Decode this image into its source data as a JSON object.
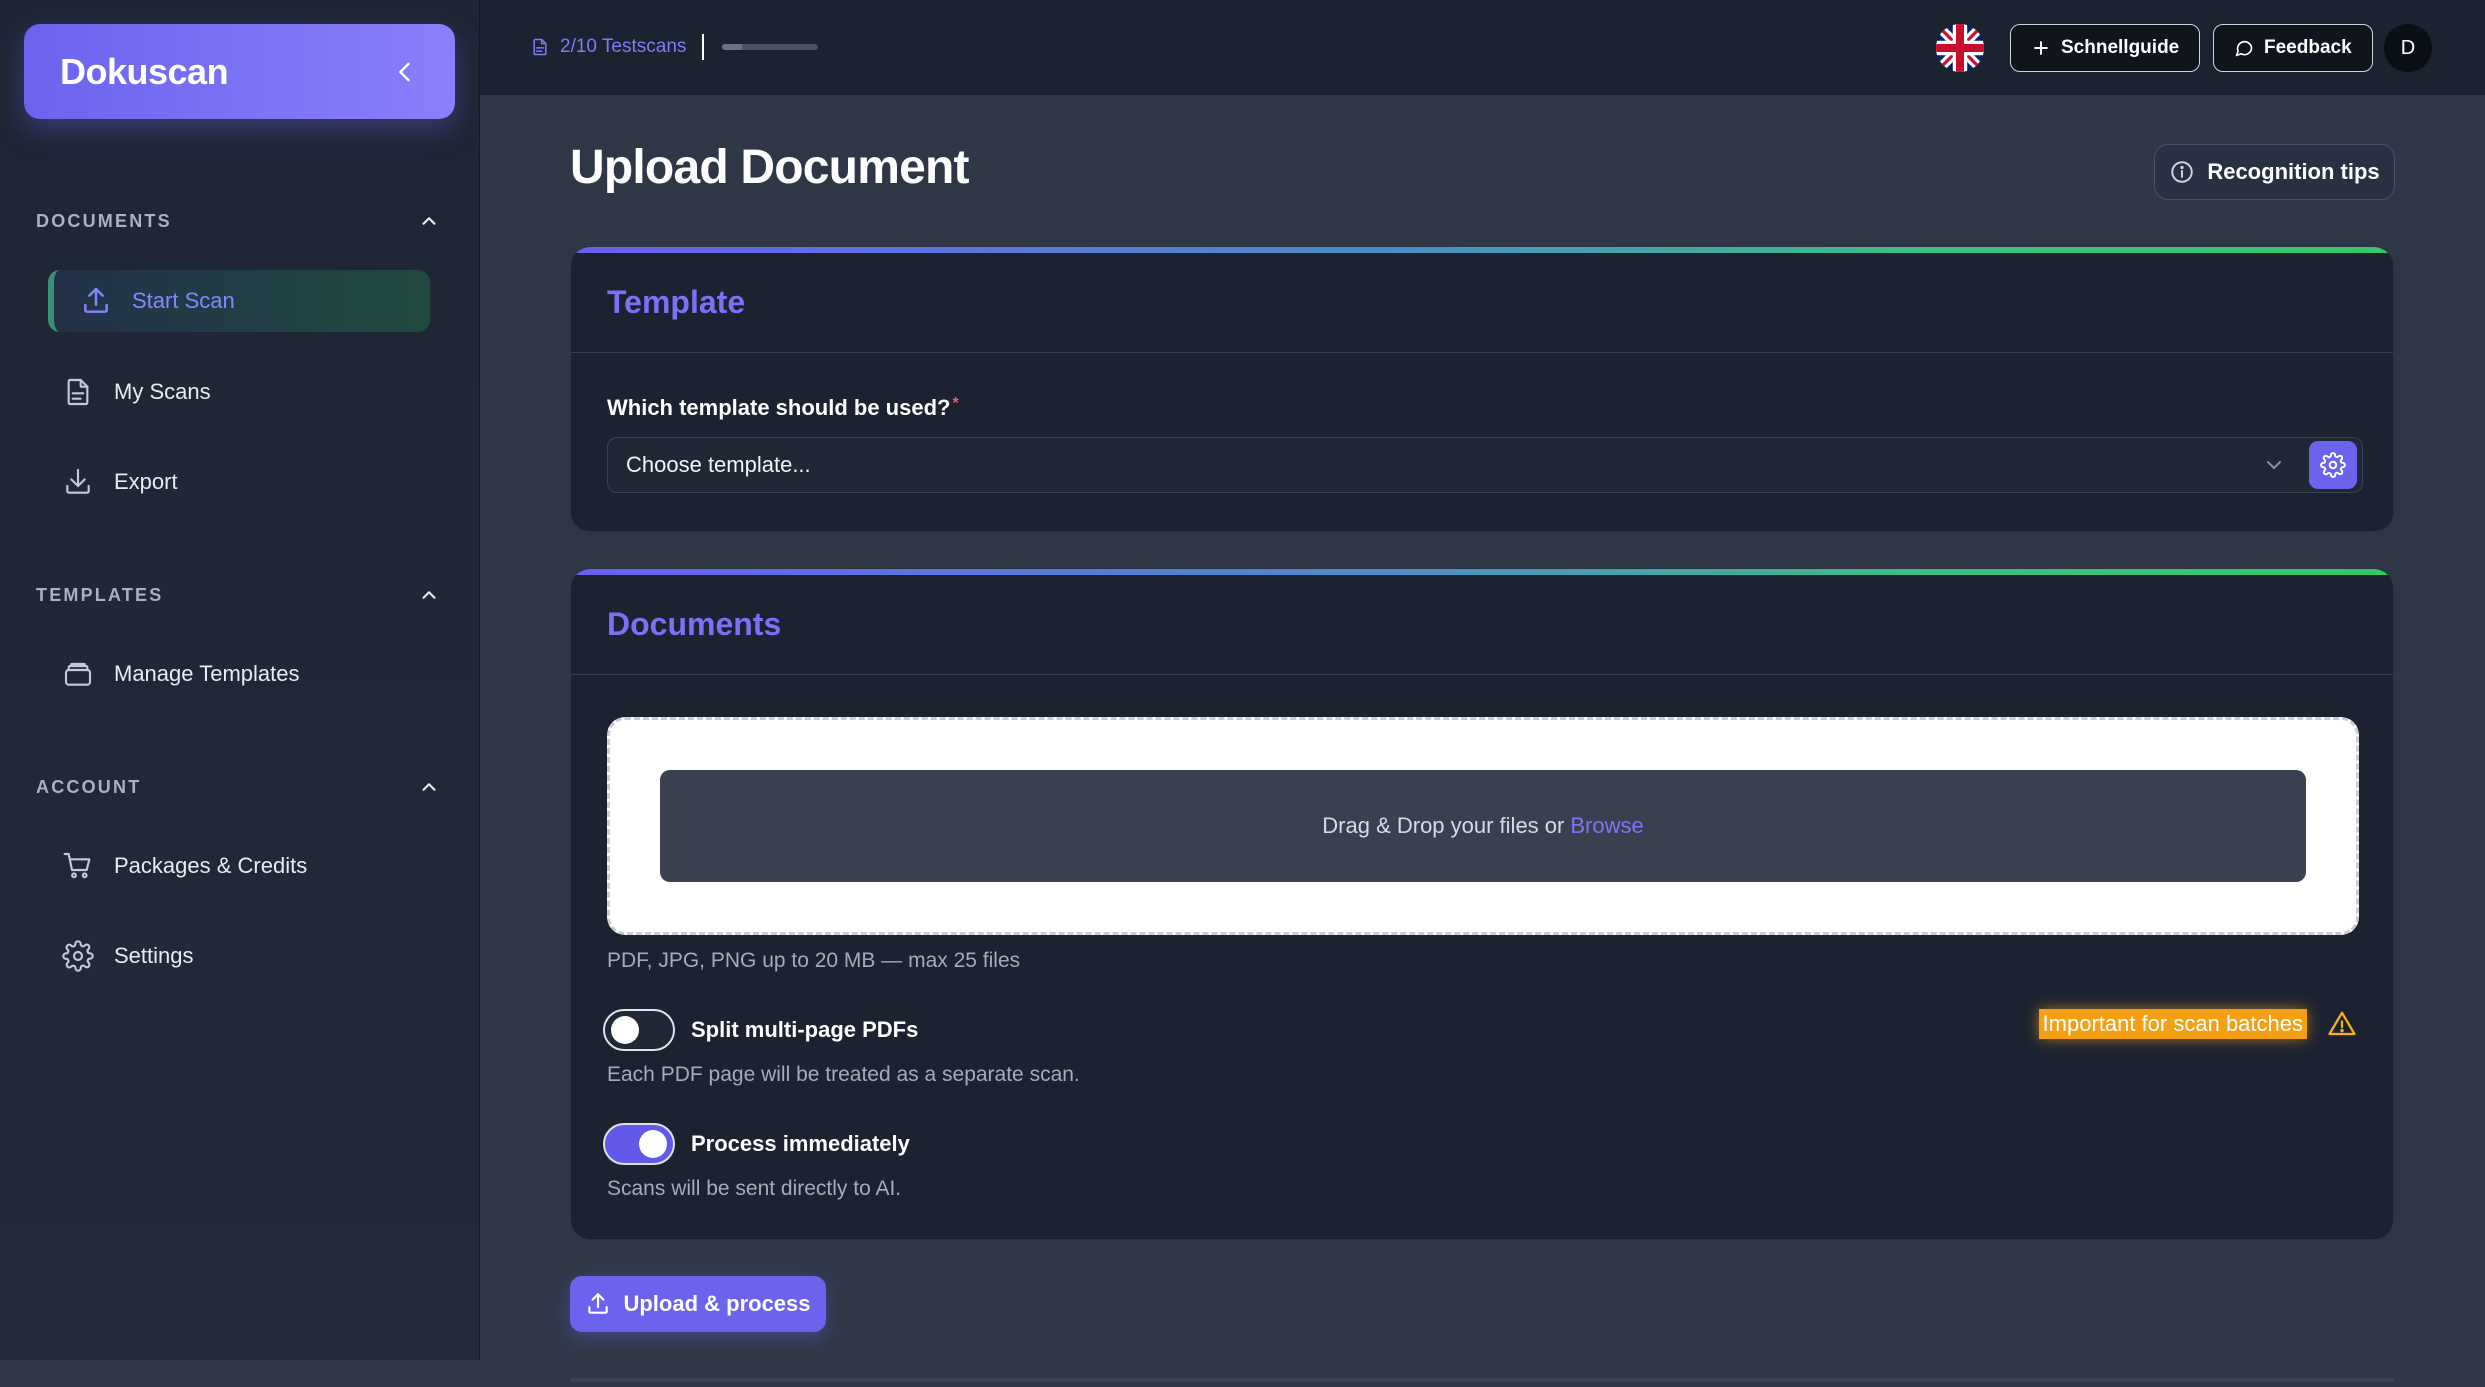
{
  "brand": {
    "title": "Dokuscan"
  },
  "sidebar": {
    "sections": [
      {
        "title": "DOCUMENTS",
        "items": [
          {
            "label": "Start Scan",
            "icon": "upload-icon",
            "active": true
          },
          {
            "label": "My Scans",
            "icon": "file-icon"
          },
          {
            "label": "Export",
            "icon": "download-icon"
          }
        ]
      },
      {
        "title": "TEMPLATES",
        "items": [
          {
            "label": "Manage Templates",
            "icon": "template-stack-icon"
          }
        ]
      },
      {
        "title": "ACCOUNT",
        "items": [
          {
            "label": "Packages & Credits",
            "icon": "cart-icon"
          },
          {
            "label": "Settings",
            "icon": "gear-icon"
          }
        ]
      }
    ]
  },
  "topbar": {
    "scan_count": "2/10 Testscans",
    "scan_progress_fraction": 0.2,
    "language_icon": "uk-flag-icon",
    "quickguide_label": "Schnellguide",
    "feedback_label": "Feedback",
    "avatar_initial": "D"
  },
  "main": {
    "title": "Upload Document",
    "tips_label": "Recognition tips",
    "template_card": {
      "heading": "Template",
      "field_label": "Which template should be used?",
      "required_mark": "*",
      "select_value": "Choose template..."
    },
    "documents_card": {
      "heading": "Documents",
      "drop_text": "Drag & Drop your files or",
      "browse_label": "Browse",
      "file_hint": "PDF, JPG, PNG up to 20 MB — max 25 files",
      "split_label": "Split multi-page PDFs",
      "split_on": false,
      "split_hint": "Each PDF page will be treated as a separate scan.",
      "badge": "Important for scan batches",
      "process_label": "Process immediately",
      "process_on": true,
      "process_hint": "Scans will be sent directly to AI."
    },
    "submit_label": "Upload & process"
  },
  "colors": {
    "accent": "#6b63ee",
    "warning": "#f5a014",
    "gradient_end": "#35c768"
  }
}
